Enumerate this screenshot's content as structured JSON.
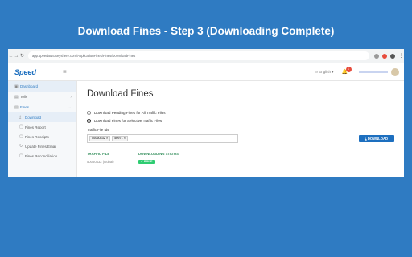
{
  "banner": {
    "title": "Download Fines - Step 3 (Downloading Complete)"
  },
  "browser": {
    "url": "app.speedau.tokeyshere.com/ApplicationFines/Fines/DownloadFines"
  },
  "app": {
    "logo": "Speed",
    "language": "English",
    "notification_count": "1"
  },
  "sidebar": {
    "items": [
      {
        "label": "Dashboard"
      },
      {
        "label": "Tolls"
      },
      {
        "label": "Fines"
      },
      {
        "label": "Download"
      },
      {
        "label": "Fines Report"
      },
      {
        "label": "Fines Receipts"
      },
      {
        "label": "Update Fines/Email"
      },
      {
        "label": "Fines Reconciliation"
      }
    ]
  },
  "main": {
    "title": "Download Fines",
    "option_all": "Download Pending Fines for All Traffic Files",
    "option_selective": "Download Fines for Selective Traffic Files",
    "field_label": "Traffic File Ids",
    "tags": [
      "50060432",
      "50971"
    ],
    "download_button": "DOWNLOAD",
    "col_traffic_file": "TRAFFIC FILE",
    "col_status": "DOWNLOADING STATUS",
    "row_file": "50060432 (Dubai)",
    "row_status": "DONE"
  }
}
